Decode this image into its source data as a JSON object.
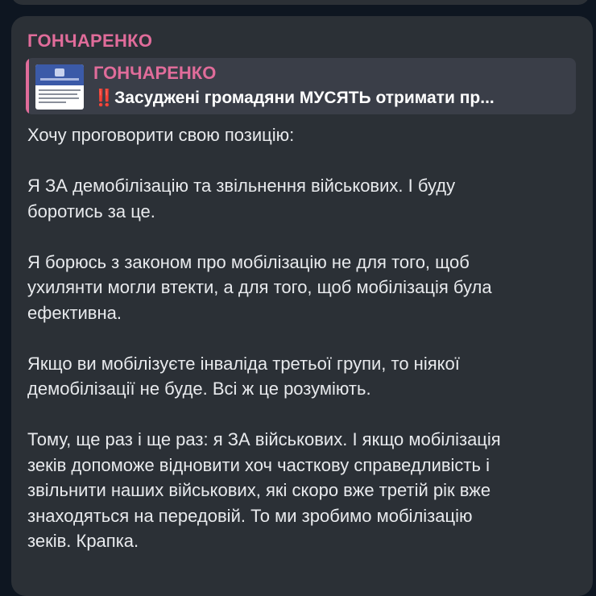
{
  "message": {
    "author": "ГОНЧАРЕНКО",
    "forward": {
      "author": "ГОНЧАРЕНКО",
      "emoji": "‼️",
      "text": "Засуджені громадяни МУСЯТЬ отримати пр..."
    },
    "paragraphs": [
      [
        "Хочу проговорити свою позицію:"
      ],
      [
        "Я ЗА демобілізацію та звільнення військових. І буду",
        "боротись за це."
      ],
      [
        "Я борюсь з законом про мобілізацію не для того, щоб",
        "ухилянти могли втекти, а для того, щоб мобілізація була",
        "ефективна."
      ],
      [
        "Якщо ви мобілізуєте інваліда третьої групи, то ніякої",
        "демобілізації не буде. Всі ж це розуміють."
      ],
      [
        "Тому, ще раз і ще раз: я ЗА військових. І якщо мобілізація",
        "зеків допоможе відновити хоч часткову справедливість і",
        "звільнити наших військових, які скоро вже третій рік вже",
        "знаходяться на передовій. То ми зробимо мобілізацію",
        "зеків. Крапка."
      ]
    ]
  }
}
